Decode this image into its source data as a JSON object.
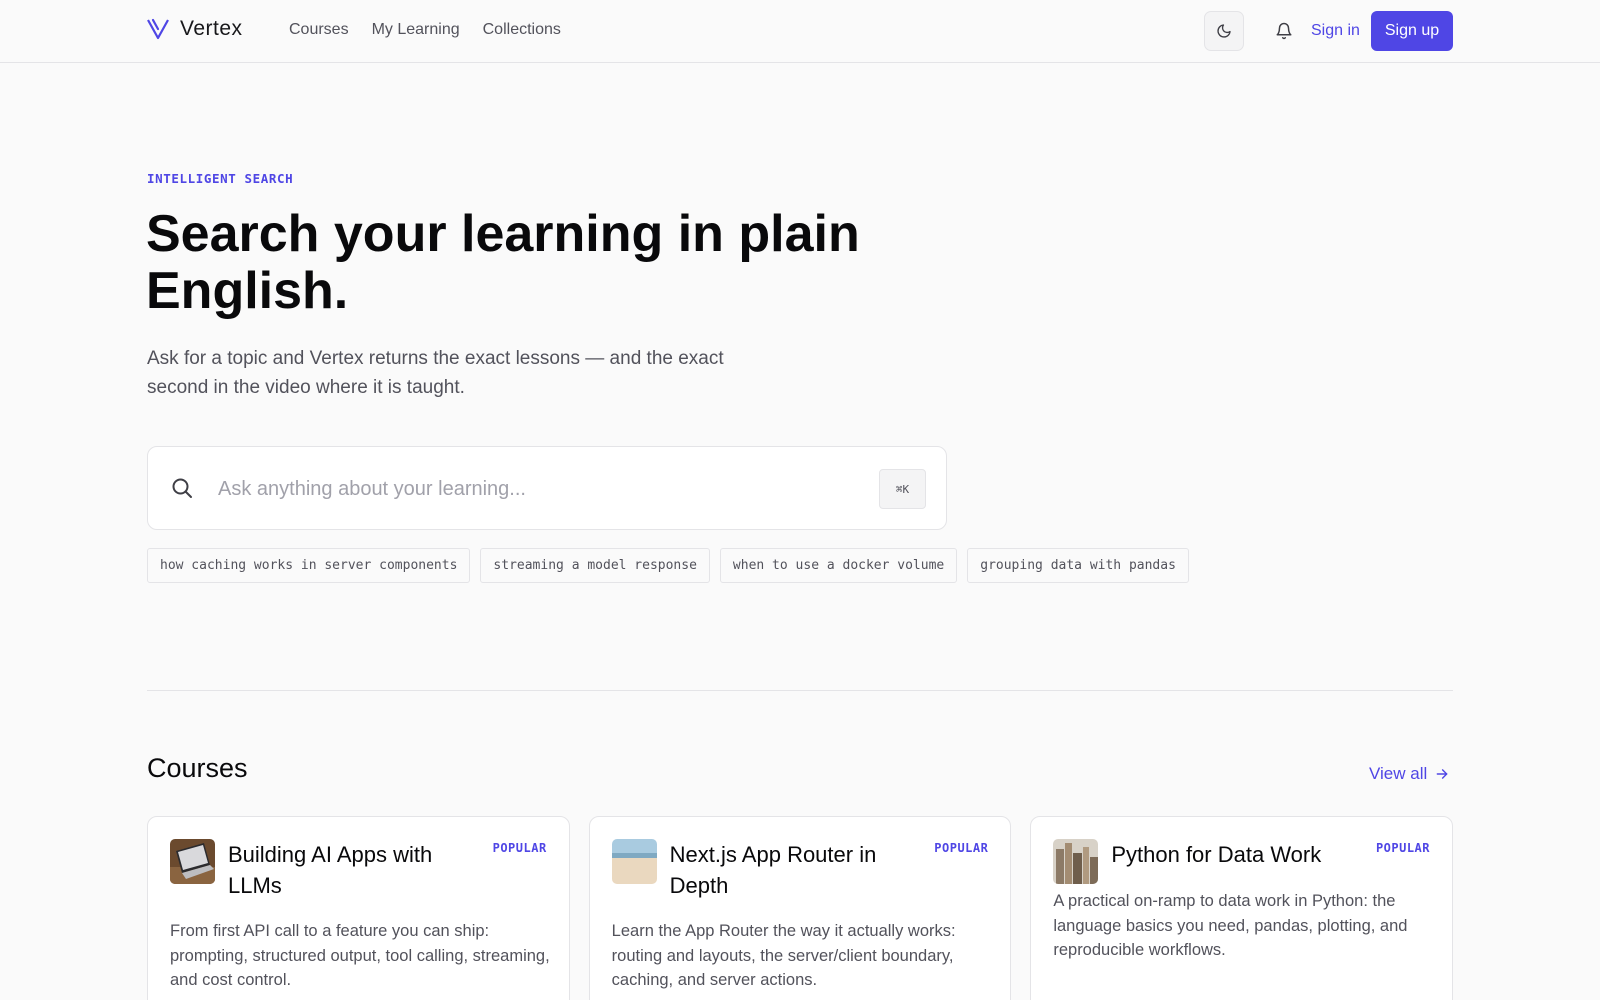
{
  "header": {
    "logo_text": "Vertex",
    "nav": [
      "Courses",
      "My Learning",
      "Collections"
    ],
    "sign_in": "Sign in",
    "sign_up": "Sign up",
    "accent_color": "#4f46e5"
  },
  "hero": {
    "eyebrow": "INTELLIGENT SEARCH",
    "title": "Search your learning in plain English.",
    "subtitle": "Ask for a topic and Vertex returns the exact lessons — and the exact second in the video where it is taught.",
    "search_placeholder": "Ask anything about your learning...",
    "shortcut": "⌘K",
    "suggestions": [
      "how caching works in server components",
      "streaming a model response",
      "when to use a docker volume",
      "grouping data with pandas"
    ]
  },
  "courses": {
    "title": "Courses",
    "view_all": "View all",
    "items": [
      {
        "title": "Building AI Apps with LLMs",
        "badge": "POPULAR",
        "description": "From first API call to a feature you can ship: prompting, structured output, tool calling, streaming, and cost control."
      },
      {
        "title": "Next.js App Router in Depth",
        "badge": "POPULAR",
        "description": "Learn the App Router the way it actually works: routing and layouts, the server/client boundary, caching, and server actions."
      },
      {
        "title": "Python for Data Work",
        "badge": "POPULAR",
        "description": "A practical on-ramp to data work in Python: the language basics you need, pandas, plotting, and reproducible workflows."
      }
    ]
  }
}
